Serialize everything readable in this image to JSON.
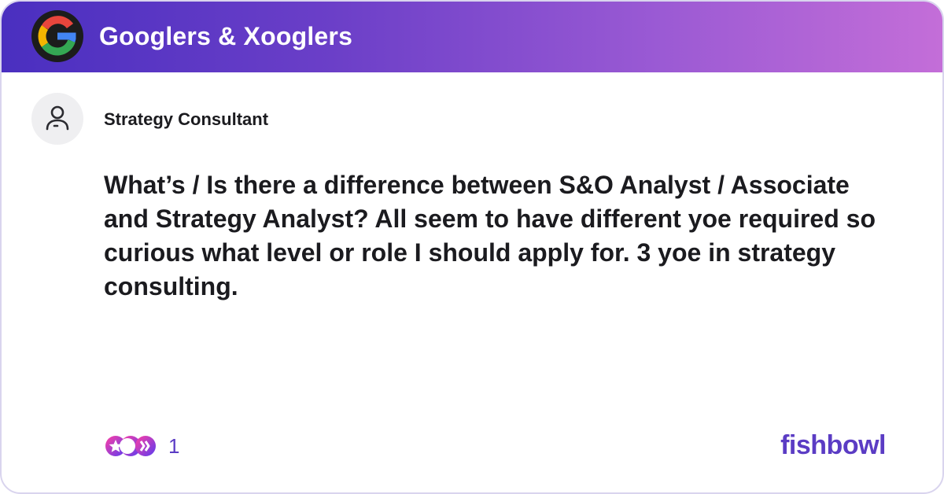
{
  "header": {
    "group_name": "Googlers & Xooglers",
    "logo_icon": "google-g-logo",
    "gradient": [
      "#4a2fc0",
      "#c46ed8"
    ]
  },
  "post": {
    "author_title": "Strategy Consultant",
    "avatar_icon": "user-icon",
    "body": "What’s / Is there a difference between S&O Analyst / Associate and Strategy Analyst? All seem to have different yoe required so curious what level or role I should apply for. 3 yoe in strategy consulting."
  },
  "footer": {
    "reaction_icons": "reaction-icons",
    "reaction_count": "1",
    "brand": "fishbowl",
    "accent_color": "#5b3cc4"
  }
}
